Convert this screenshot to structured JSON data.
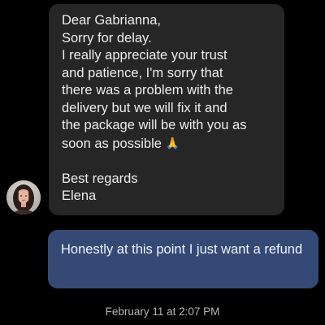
{
  "incoming_message": {
    "lines": [
      "Dear Gabrianna,",
      "Sorry for delay.",
      "I really appreciate your trust",
      "and patience, I'm sorry that",
      "there was a problem with the",
      "delivery but we will fix it and",
      "the package will be with you as",
      "soon as possible"
    ],
    "emoji": "🙏",
    "signoff": [
      "Best regards",
      "Elena"
    ]
  },
  "outgoing_message": {
    "text": "Honestly at this point I just want a refund"
  },
  "timestamp": "February 11 at 2:07 PM",
  "colors": {
    "background": "#000000",
    "incoming_bubble": "#262626",
    "outgoing_bubble": "#344a75",
    "incoming_text": "#ededed",
    "timestamp_text": "#b5b5b5"
  }
}
